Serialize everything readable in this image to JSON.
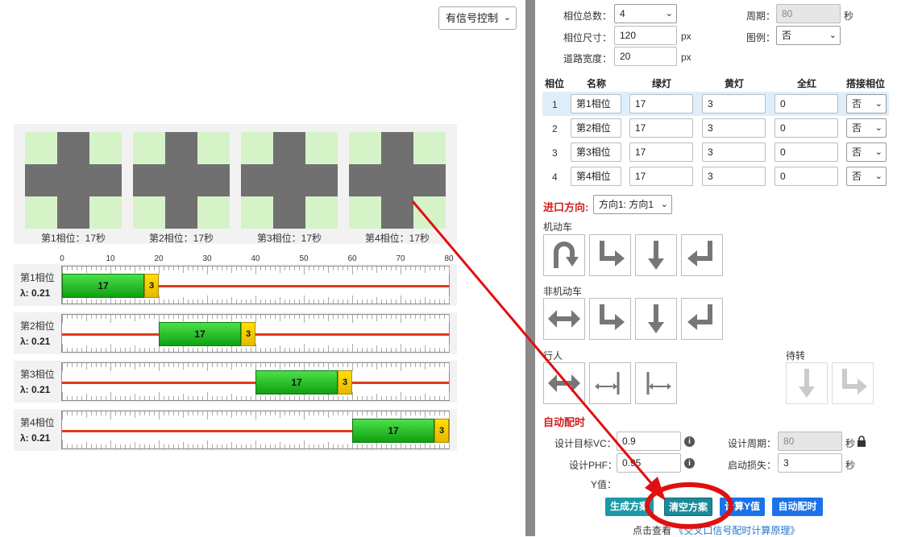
{
  "left": {
    "mode_select": "有信号控制",
    "phases": [
      {
        "label": "第1相位：17秒"
      },
      {
        "label": "第2相位：17秒"
      },
      {
        "label": "第3相位：17秒"
      },
      {
        "label": "第4相位：17秒"
      }
    ],
    "timeline": {
      "ticks": [
        "0",
        "10",
        "20",
        "30",
        "40",
        "50",
        "60",
        "70",
        "80"
      ],
      "rows": [
        {
          "name": "第1相位",
          "lambda": "λ: 0.21",
          "green": "17",
          "yellow": "3",
          "start": 0
        },
        {
          "name": "第2相位",
          "lambda": "λ: 0.21",
          "green": "17",
          "yellow": "3",
          "start": 20
        },
        {
          "name": "第3相位",
          "lambda": "λ: 0.21",
          "green": "17",
          "yellow": "3",
          "start": 40
        },
        {
          "name": "第4相位",
          "lambda": "λ: 0.21",
          "green": "17",
          "yellow": "3",
          "start": 60
        }
      ],
      "cycle": 80
    }
  },
  "right": {
    "phase_count_label": "相位总数：",
    "phase_count": "4",
    "period_label": "周期：",
    "period": "80",
    "period_unit": "秒",
    "phase_size_label": "相位尺寸：",
    "phase_size": "120",
    "px1": "px",
    "legend_label": "图例：",
    "legend": "否",
    "road_width_label": "道路宽度：",
    "road_width": "20",
    "px2": "px",
    "table_headers": [
      "相位",
      "名称",
      "绿灯",
      "黄灯",
      "全红",
      "搭接相位"
    ],
    "table_rows": [
      {
        "idx": "1",
        "name": "第1相位",
        "green": "17",
        "yellow": "3",
        "red": "0",
        "overlap": "否"
      },
      {
        "idx": "2",
        "name": "第2相位",
        "green": "17",
        "yellow": "3",
        "red": "0",
        "overlap": "否"
      },
      {
        "idx": "3",
        "name": "第3相位",
        "green": "17",
        "yellow": "3",
        "red": "0",
        "overlap": "否"
      },
      {
        "idx": "4",
        "name": "第4相位",
        "green": "17",
        "yellow": "3",
        "red": "0",
        "overlap": "否"
      }
    ],
    "approach_label": "进口方向:",
    "approach_value": "方向1: 方向1",
    "motor_label": "机动车",
    "nonmotor_label": "非机动车",
    "ped_label": "行人",
    "wait_label": "待转",
    "auto_title": "自动配时",
    "vc_label": "设计目标VC：",
    "vc_value": "0.9",
    "design_cycle_label": "设计周期：",
    "design_cycle": "80",
    "design_cycle_unit": "秒",
    "phf_label": "设计PHF：",
    "phf_value": "0.95",
    "start_loss_label": "启动损失：",
    "start_loss": "3",
    "start_loss_unit": "秒",
    "y_label": "Y值：",
    "buttons": {
      "generate": "生成方案",
      "clear": "清空方案",
      "calc_y": "计算Y值",
      "auto": "自动配时"
    },
    "link_prefix": "点击查看",
    "link_text": "《交叉口信号配时计算原理》"
  },
  "colors": {
    "green": "#10a010",
    "yellow": "#e5b800",
    "red_line": "#e03a1c",
    "teal_btn": "#1a9aa8",
    "blue_btn": "#1a73e8",
    "annotation_red": "#e01010"
  }
}
